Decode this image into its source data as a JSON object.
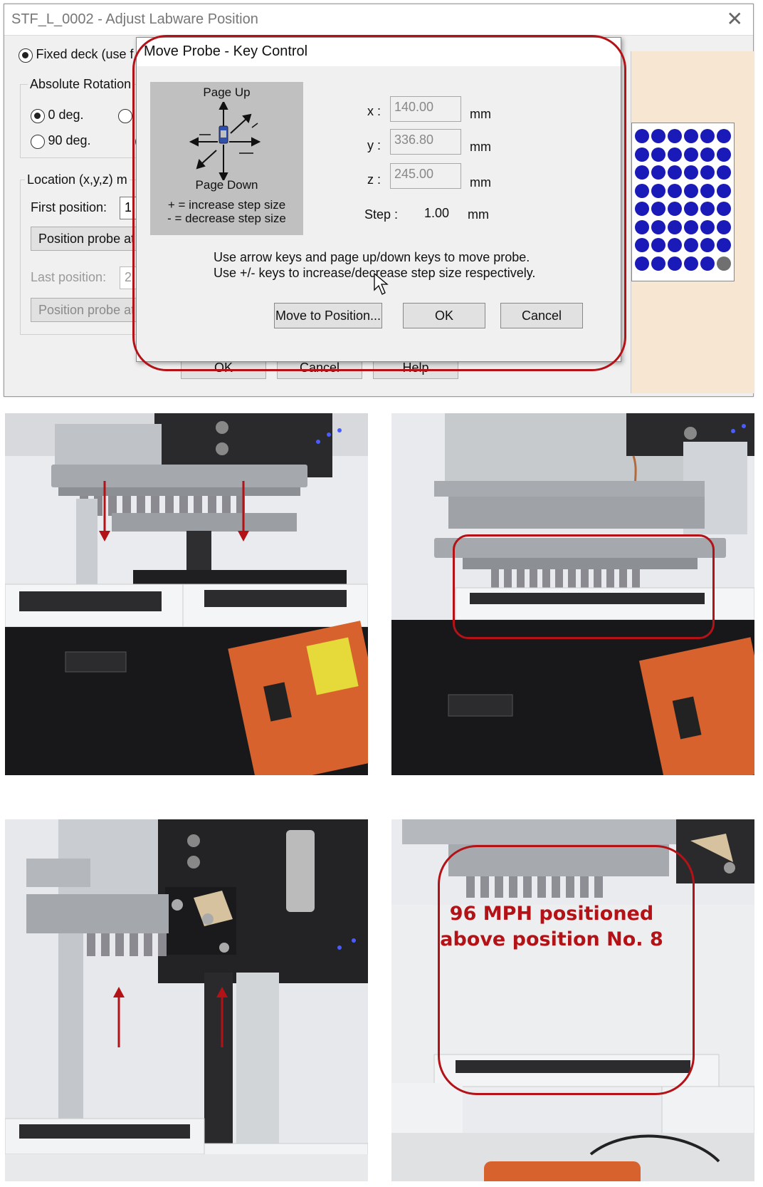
{
  "outer_dialog": {
    "title": "STF_L_0002 - Adjust Labware Position",
    "close_glyph": "✕",
    "fixed_deck_label": "Fixed deck (use f",
    "rotation_group_label": "Absolute Rotation",
    "rotation_0": "0 deg.",
    "rotation_90": "90 deg.",
    "location_label": "Location (x,y,z) m",
    "first_position_label": "First position:",
    "first_position_value": "1",
    "position_probe_button": "Position probe at",
    "last_position_label": "Last position:",
    "last_position_value": "2",
    "position_probe_button_2": "Position probe at",
    "ok_label": "OK",
    "cancel_label": "Cancel",
    "help_label": "Help"
  },
  "probe_dialog": {
    "title": "Move Probe - Key Control",
    "page_up": "Page Up",
    "page_down": "Page Down",
    "increase_hint": "+ = increase step size",
    "decrease_hint": "- = decrease step size",
    "x_label": "x :",
    "y_label": "y :",
    "z_label": "z :",
    "x_value": "140.00",
    "y_value": "336.80",
    "z_value": "245.00",
    "unit": "mm",
    "step_label": "Step :",
    "step_value": "1.00",
    "instruction_1": "Use arrow keys and page up/down keys to move probe.",
    "instruction_2": "Use +/- keys to increase/decrease step size respectively.",
    "move_button": "Move to Position...",
    "ok_button": "OK",
    "cancel_button": "Cancel"
  },
  "colors": {
    "annotation_red": "#b31217",
    "well_blue": "#1a1ab8",
    "well_empty": "#707070"
  },
  "photo_caption_line1": "96 MPH positioned",
  "photo_caption_line2": "above position No. 8"
}
